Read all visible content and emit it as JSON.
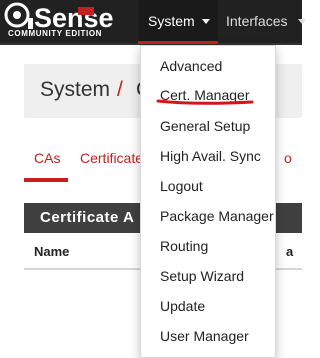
{
  "brand": {
    "logo_text": "Sense",
    "edition": "COMMUNITY EDITION"
  },
  "navbar": {
    "system": "System",
    "interfaces": "Interfaces"
  },
  "breadcrumb": {
    "title": "System",
    "separator": "/",
    "more": "C"
  },
  "tabs": {
    "cas": "CAs",
    "certificates": "Certificate",
    "more": "o"
  },
  "table": {
    "title": "Certificate A",
    "column_name": "Name",
    "right_fragment": "a"
  },
  "dropdown": {
    "items": [
      "Advanced",
      "Cert. Manager",
      "General Setup",
      "High Avail. Sync",
      "Logout",
      "Package Manager",
      "Routing",
      "Setup Wizard",
      "Update",
      "User Manager"
    ]
  },
  "colors": {
    "accent": "#c61f1f",
    "navbar": "#212121",
    "table_header": "#404040"
  }
}
